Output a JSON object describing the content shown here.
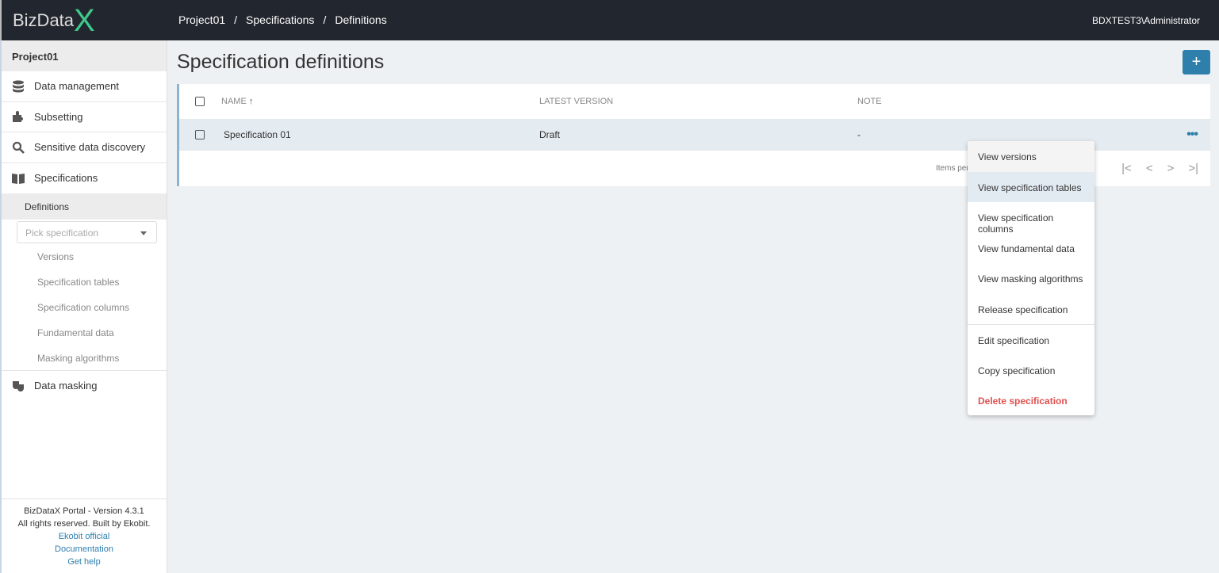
{
  "header": {
    "logo": "BizData",
    "logo_x": "X",
    "breadcrumb": [
      "Project01",
      "Specifications",
      "Definitions"
    ],
    "user": "BDXTEST3\\Administrator"
  },
  "sidebar": {
    "project": "Project01",
    "items": [
      {
        "label": "Data management",
        "icon": "database-icon"
      },
      {
        "label": "Subsetting",
        "icon": "puzzle-icon"
      },
      {
        "label": "Sensitive data discovery",
        "icon": "search-icon"
      },
      {
        "label": "Specifications",
        "icon": "book-icon"
      }
    ],
    "active_sub": "Definitions",
    "pick_placeholder": "Pick specification",
    "sub_items": [
      "Versions",
      "Specification tables",
      "Specification columns",
      "Fundamental data",
      "Masking algorithms"
    ],
    "data_masking": "Data masking",
    "footer": {
      "version": "BizDataX Portal - Version 4.3.1",
      "rights": "All rights reserved. Built by Ekobit.",
      "links": [
        "Ekobit official",
        "Documentation",
        "Get help"
      ]
    }
  },
  "main": {
    "title": "Specification definitions",
    "add_label": "+",
    "columns": [
      "NAME",
      "LATEST VERSION",
      "NOTE"
    ],
    "sort_arrow": "↑",
    "rows": [
      {
        "name": "Specification 01",
        "version": "Draft",
        "note": "-"
      }
    ],
    "items_per": "Items per",
    "pager": [
      "|<",
      "<",
      ">",
      ">|"
    ]
  },
  "menu": [
    "View versions",
    "View specification tables",
    "View specification columns",
    "View fundamental data",
    "View masking algorithms",
    "Release specification",
    "Edit specification",
    "Copy specification",
    "Delete specification"
  ],
  "colors": {
    "accent": "#2f7fac",
    "danger": "#e05050",
    "topbar": "#22262e"
  }
}
